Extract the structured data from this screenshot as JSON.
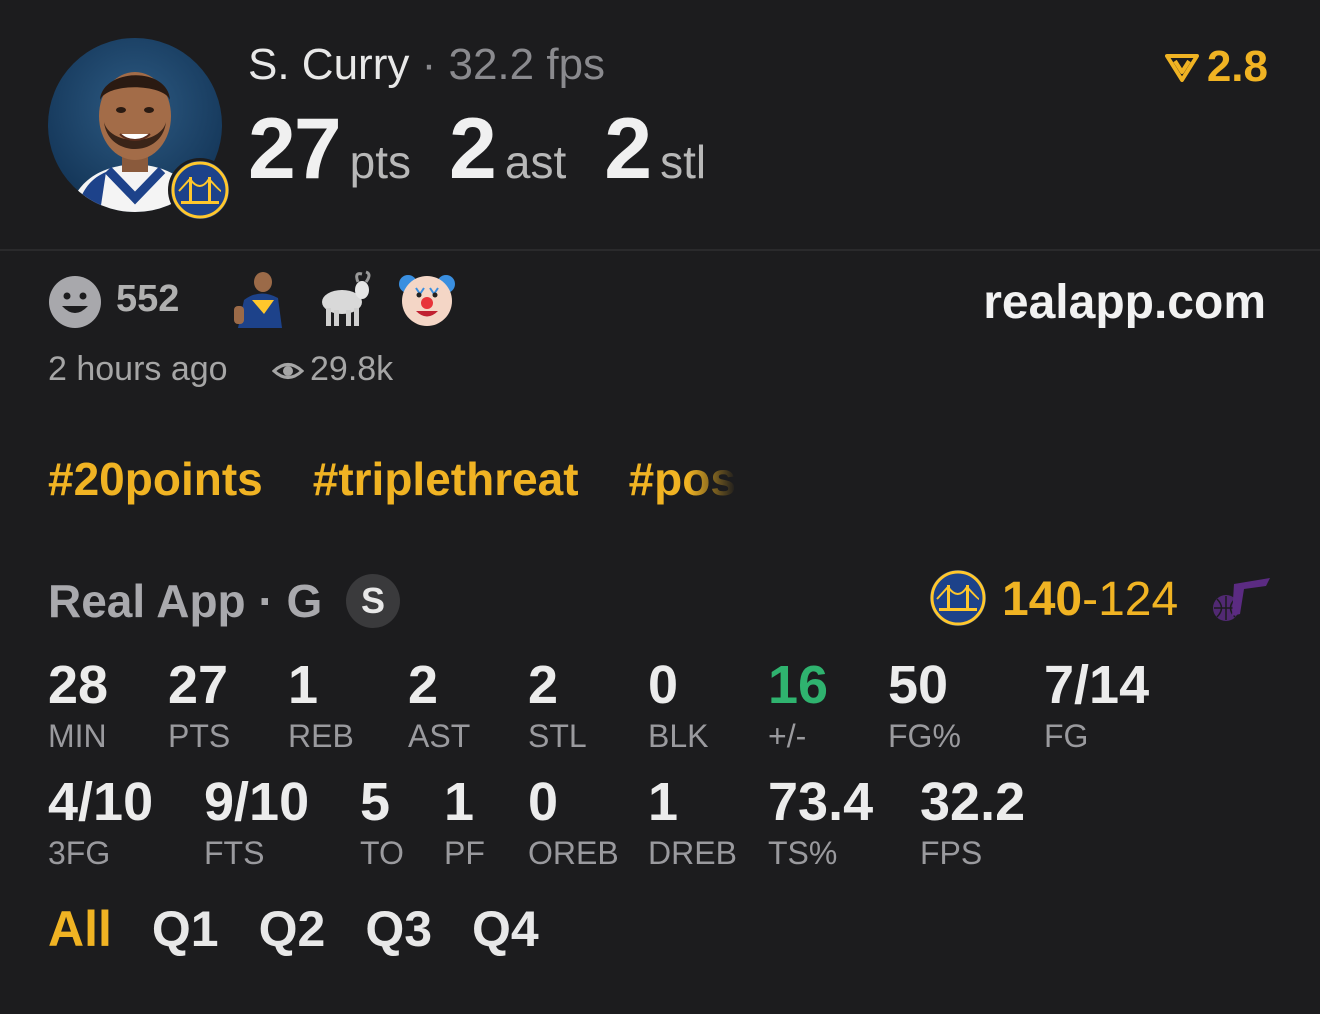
{
  "player": {
    "name": "S. Curry",
    "separator": "·",
    "fps": "32.2 fps",
    "stats": [
      {
        "value": "27",
        "unit": "pts"
      },
      {
        "value": "2",
        "unit": "ast"
      },
      {
        "value": "2",
        "unit": "stl"
      }
    ],
    "score": "2.8"
  },
  "reactions": {
    "count": "552",
    "emojis": [
      "curry-photo-reaction",
      "goat-reaction",
      "clown-reaction"
    ],
    "site": "realapp.com",
    "time": "2 hours ago",
    "views": "29.8k"
  },
  "hashtags": [
    "#20points",
    "#triplethreat",
    "#pos"
  ],
  "game": {
    "source": "Real App · G",
    "badge": "S",
    "score_home": "140",
    "score_dash": "-",
    "score_away": "124"
  },
  "stats_row1": [
    {
      "value": "28",
      "label": "MIN"
    },
    {
      "value": "27",
      "label": "PTS"
    },
    {
      "value": "1",
      "label": "REB"
    },
    {
      "value": "2",
      "label": "AST"
    },
    {
      "value": "2",
      "label": "STL"
    },
    {
      "value": "0",
      "label": "BLK"
    },
    {
      "value": "16",
      "label": "+/-"
    },
    {
      "value": "50",
      "label": "FG%"
    },
    {
      "value": "7/14",
      "label": "FG"
    }
  ],
  "stats_row2": [
    {
      "value": "4/10",
      "label": "3FG"
    },
    {
      "value": "9/10",
      "label": "FTS"
    },
    {
      "value": "5",
      "label": "TO"
    },
    {
      "value": "1",
      "label": "PF"
    },
    {
      "value": "0",
      "label": "OREB"
    },
    {
      "value": "1",
      "label": "DREB"
    },
    {
      "value": "73.4",
      "label": "TS%"
    },
    {
      "value": "32.2",
      "label": "FPS"
    }
  ],
  "quarters": {
    "tabs": [
      "All",
      "Q1",
      "Q2",
      "Q3",
      "Q4"
    ],
    "active": "All"
  },
  "colors": {
    "accent": "#f0b323",
    "positive": "#2fb36f",
    "background": "#1c1c1e",
    "warriors": "#1d428a",
    "jazz": "#5b2b82"
  }
}
